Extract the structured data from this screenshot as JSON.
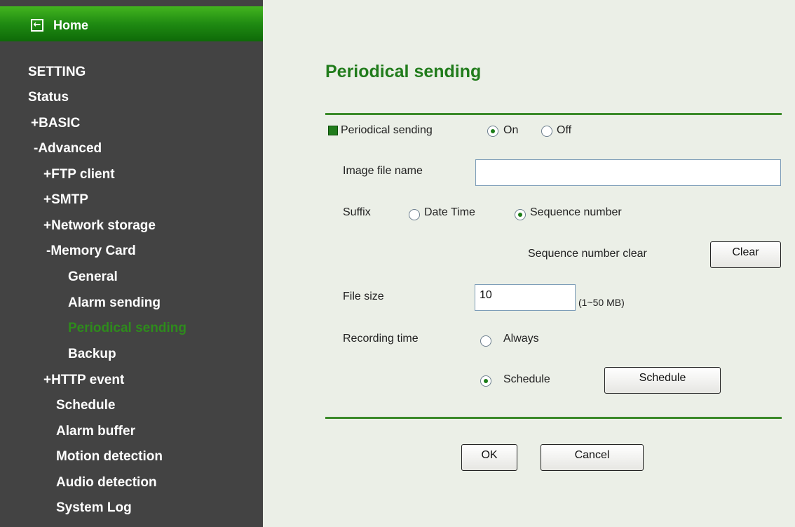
{
  "sidebar": {
    "home_label": "Home",
    "home_icon": "back-arrow-icon",
    "items": [
      {
        "label": "SETTING"
      },
      {
        "label": "Status"
      },
      {
        "label": "+BASIC"
      },
      {
        "label": "-Advanced"
      },
      {
        "label": "+FTP client"
      },
      {
        "label": "+SMTP"
      },
      {
        "label": "+Network storage"
      },
      {
        "label": "-Memory Card"
      },
      {
        "label": "General"
      },
      {
        "label": "Alarm sending"
      },
      {
        "label": "Periodical sending",
        "active": true
      },
      {
        "label": "Backup"
      },
      {
        "label": "+HTTP event"
      },
      {
        "label": "Schedule"
      },
      {
        "label": "Alarm buffer"
      },
      {
        "label": "Motion detection"
      },
      {
        "label": "Audio detection"
      },
      {
        "label": "System Log"
      }
    ],
    "active_color": "#2e8b1c"
  },
  "main": {
    "title": "Periodical sending",
    "periodical": {
      "label": "Periodical sending",
      "on_label": "On",
      "off_label": "Off",
      "selected": "On"
    },
    "image_file_name": {
      "label": "Image file name",
      "value": ""
    },
    "suffix": {
      "label": "Suffix",
      "option_date": "Date Time",
      "option_seq": "Sequence number",
      "selected": "Sequence number"
    },
    "sequence_clear": {
      "label": "Sequence number clear",
      "button": "Clear"
    },
    "file_size": {
      "label": "File size",
      "value": "10",
      "range": "(1~50 MB)"
    },
    "recording_time": {
      "label": "Recording time",
      "option_always": "Always",
      "option_schedule": "Schedule",
      "selected": "Schedule",
      "schedule_button": "Schedule"
    },
    "buttons": {
      "ok": "OK",
      "cancel": "Cancel"
    }
  },
  "colors": {
    "accent": "#217c1c",
    "sidebar_bg": "#434343",
    "page_bg": "#ebefe7"
  }
}
